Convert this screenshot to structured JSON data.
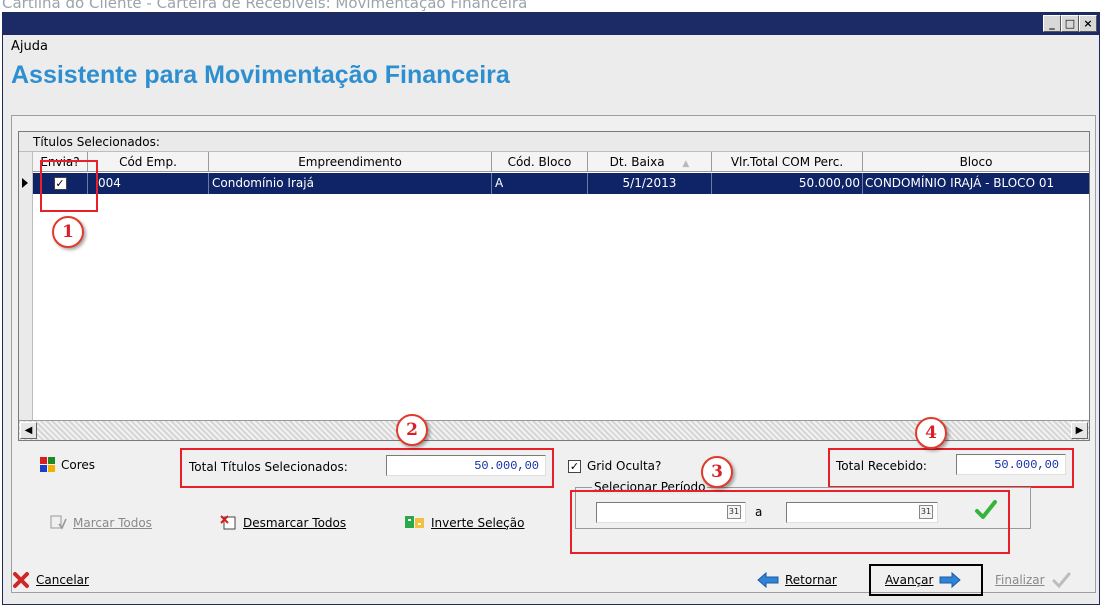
{
  "doc_caption": "Cartilha do Cliente - Carteira de Recebíveis: Movimentação Financeira",
  "menu": {
    "help": "Ajuda"
  },
  "wizard_title": "Assistente para Movimentação Financeira",
  "grid": {
    "caption": "Títulos Selecionados:",
    "columns": [
      "Envia?",
      "Cód Emp.",
      "Empreendimento",
      "Cód. Bloco",
      "Dt. Baixa",
      "Vlr.Total COM Perc.",
      "Bloco"
    ],
    "sort_indicator": "▲",
    "rows": [
      {
        "envia": true,
        "cod_emp": "004",
        "empreendimento": "Condomínio Irajá",
        "cod_bloco": "A",
        "dt_baixa": "5/1/2013",
        "vlr_total": "50.000,00",
        "bloco": "CONDOMÍNIO IRAJÁ - BLOCO 01"
      }
    ]
  },
  "callouts": [
    "1",
    "2",
    "3",
    "4"
  ],
  "cores_label": "Cores",
  "total_titulos": {
    "label": "Total Títulos Selecionados:",
    "value": "50.000,00"
  },
  "grid_oculta": {
    "label": "Grid Oculta?",
    "checked": true
  },
  "total_recebido": {
    "label": "Total Recebido:",
    "value": "50.000,00"
  },
  "actions": {
    "marcar_todos": "Marcar Todos",
    "desmarcar_todos": "Desmarcar Todos",
    "inverte_selecao": "Inverte Seleção"
  },
  "periodo": {
    "legend": "Selecionar Período",
    "separator": "a",
    "start": "",
    "end": ""
  },
  "nav": {
    "cancelar": "Cancelar",
    "retornar": "Retornar",
    "avancar": "Avançar",
    "finalizar": "Finalizar"
  },
  "colors": {
    "title_blue": "#2e8fd0",
    "selected_row": "#0f2466",
    "annotation_red": "#e8202a"
  }
}
